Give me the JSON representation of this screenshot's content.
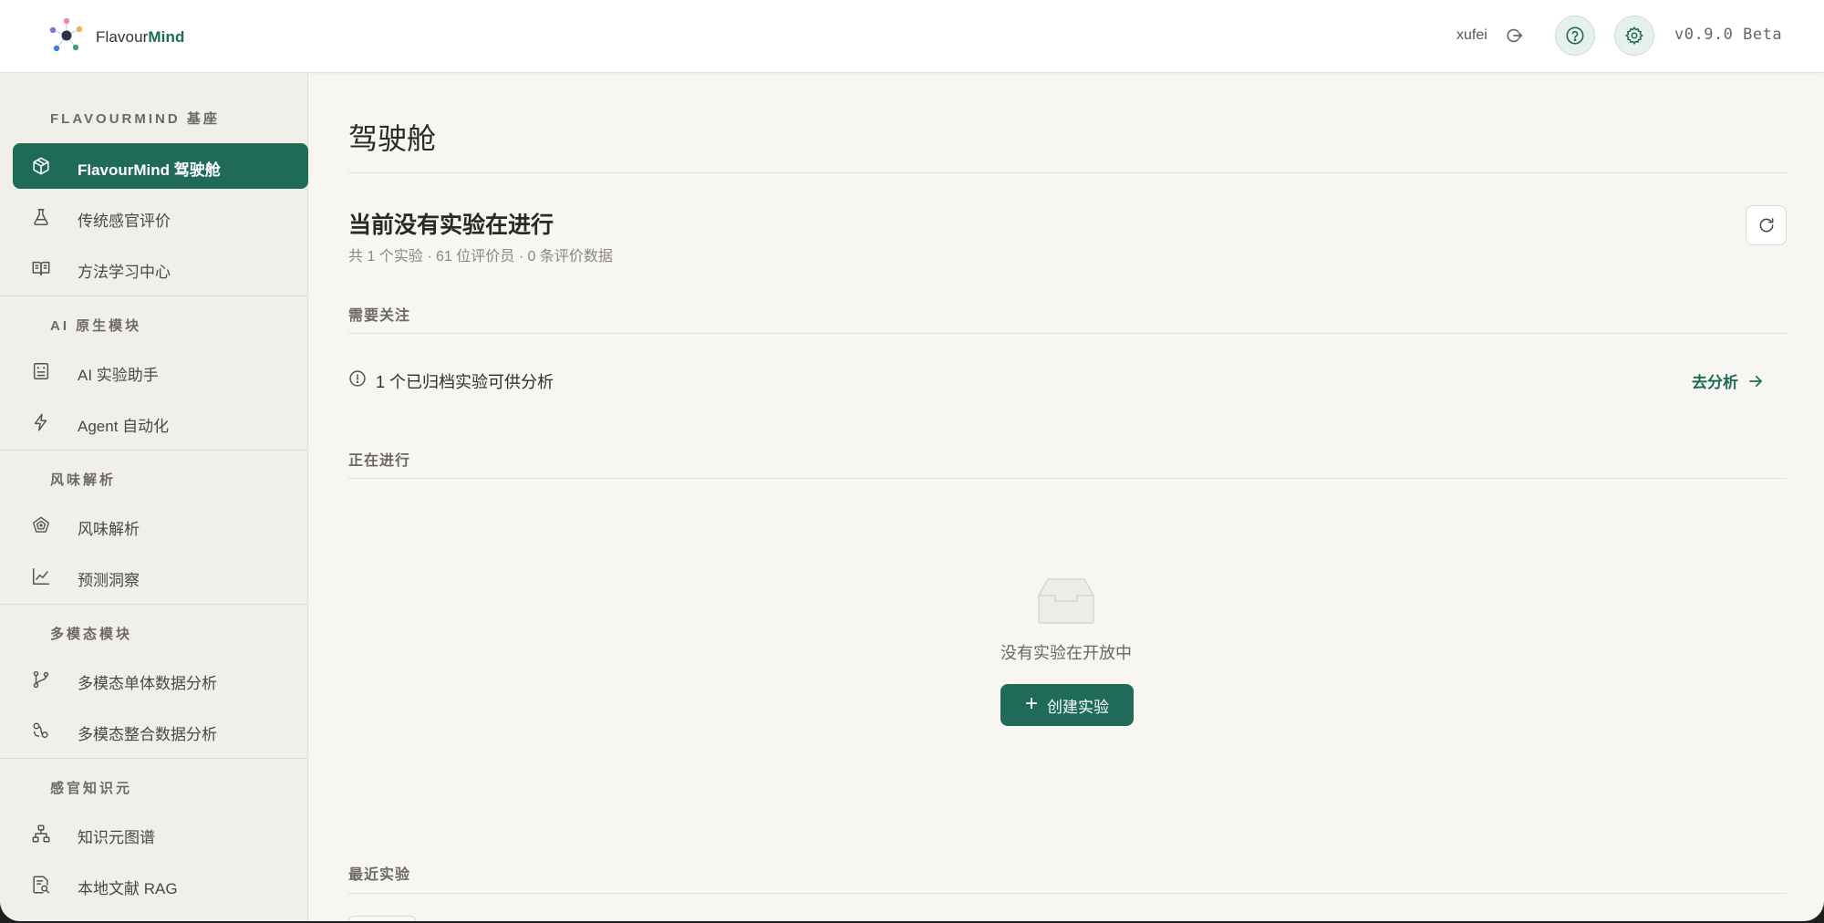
{
  "header": {
    "brand_prefix": "Flavour",
    "brand_suffix": "Mind",
    "username": "xufei",
    "version": "v0.9.0 Beta",
    "icons": {
      "logout": "logout-icon",
      "help": "help-circle-icon",
      "settings": "gear-icon"
    }
  },
  "sidebar": {
    "sections": [
      {
        "title": "FLAVOURMIND 基座"
      },
      {
        "title": "AI 原生模块"
      },
      {
        "title": "风味解析"
      },
      {
        "title": "多模态模块"
      },
      {
        "title": "感官知识元"
      }
    ],
    "items": [
      {
        "label": "FlavourMind 驾驶舱",
        "icon": "cube-icon",
        "active": true
      },
      {
        "label": "传统感官评价",
        "icon": "flask-icon"
      },
      {
        "label": "方法学习中心",
        "icon": "book-icon"
      },
      {
        "label": "AI 实验助手",
        "icon": "bot-icon"
      },
      {
        "label": "Agent 自动化",
        "icon": "lightning-icon"
      },
      {
        "label": "风味解析",
        "icon": "radar-icon"
      },
      {
        "label": "预测洞察",
        "icon": "line-chart-icon"
      },
      {
        "label": "多模态单体数据分析",
        "icon": "git-branch-icon"
      },
      {
        "label": "多模态整合数据分析",
        "icon": "merge-icon"
      },
      {
        "label": "知识元图谱",
        "icon": "network-icon"
      },
      {
        "label": "本地文献 RAG",
        "icon": "doc-search-icon"
      }
    ]
  },
  "main": {
    "page_title": "驾驶舱",
    "status_title": "当前没有实验在进行",
    "status_sub": "共 1 个实验 · 61 位评价员 · 0 条评价数据",
    "attention_heading": "需要关注",
    "alert_text": "1 个已归档实验可供分析",
    "analyze_link": "去分析",
    "ongoing_heading": "正在进行",
    "empty_text": "没有实验在开放中",
    "create_button": "创建实验",
    "recent_heading": "最近实验"
  },
  "colors": {
    "accent": "#1f6b57",
    "sidebar_bg": "#f1efea",
    "page_bg": "#f7f6f2"
  }
}
